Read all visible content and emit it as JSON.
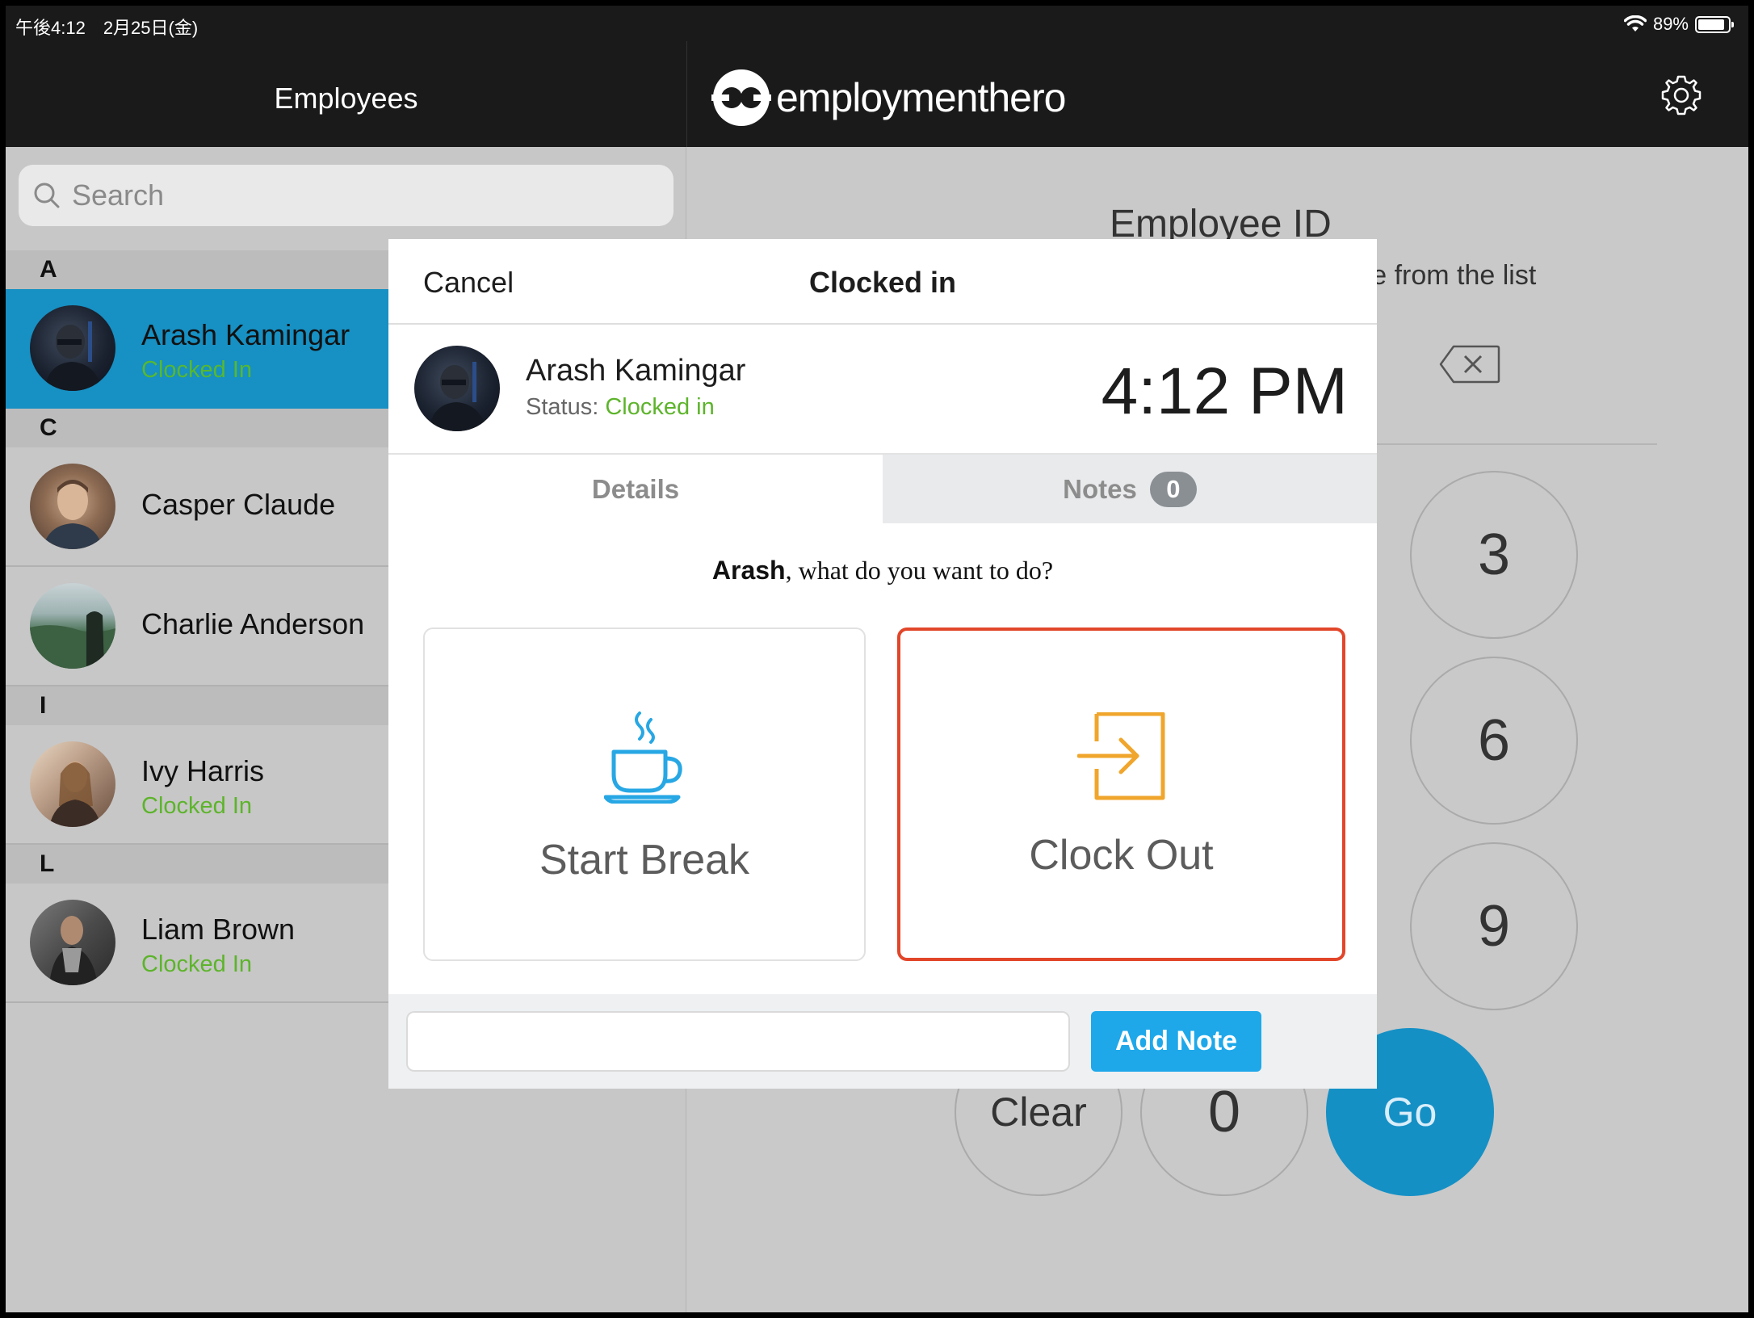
{
  "status_bar": {
    "time_date": "午後4:12　2月25日(金)",
    "battery": "89%",
    "battery_level": 0.89
  },
  "left_header": {
    "title": "Employees"
  },
  "brand": {
    "name": "employmenthero"
  },
  "search": {
    "placeholder": "Search"
  },
  "sections": [
    "A",
    "C",
    "I",
    "L"
  ],
  "employees": [
    {
      "name": "Arash Kamingar",
      "status": "Clocked In",
      "selected": true
    },
    {
      "name": "Casper Claude",
      "status": ""
    },
    {
      "name": "Charlie Anderson",
      "status": ""
    },
    {
      "name": "Ivy Harris",
      "status": "Clocked In"
    },
    {
      "name": "Liam Brown",
      "status": "Clocked In"
    }
  ],
  "keypad": {
    "title": "Employee ID",
    "subtitle": "ame from the list",
    "keys": [
      "3",
      "6",
      "9",
      "Clear",
      "0",
      "Go"
    ]
  },
  "modal": {
    "cancel": "Cancel",
    "title": "Clocked in",
    "user_name": "Arash Kamingar",
    "status_label": "Status:",
    "status_value": "Clocked in",
    "time": "4:12 PM",
    "tab_details": "Details",
    "tab_notes": "Notes",
    "notes_count": "0",
    "prompt_name": "Arash",
    "prompt_rest": ", what do you want to do?",
    "action_break": "Start Break",
    "action_clockout": "Clock Out",
    "add_note": "Add Note",
    "note_value": ""
  },
  "colors": {
    "accent": "#1790c3",
    "status_green": "#5db42b",
    "break_icon": "#27a7e4",
    "clockout_icon": "#f0a62c",
    "selected_border": "#e2462a"
  }
}
